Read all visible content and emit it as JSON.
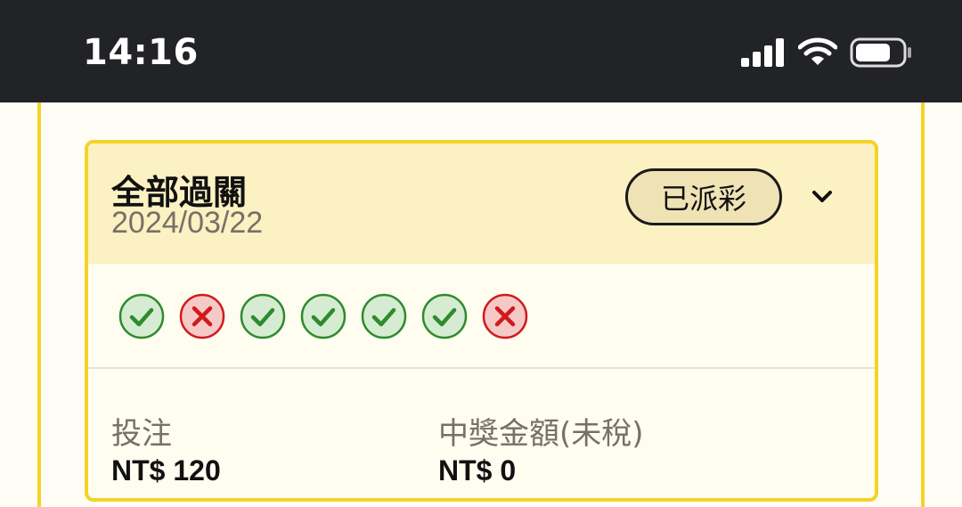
{
  "status_bar": {
    "time": "14:16"
  },
  "bet_card": {
    "type": "全部過關",
    "date": "2024/03/22",
    "status": "已派彩",
    "results": [
      "win",
      "lose",
      "win",
      "win",
      "win",
      "win",
      "lose"
    ],
    "stake": {
      "label": "投注",
      "value": "NT$ 120"
    },
    "payout": {
      "label": "中獎金額(未稅)",
      "value": "NT$ 0"
    }
  },
  "colors": {
    "accent": "#f5d326",
    "header_bg": "#fcf1c3",
    "win": "#2e8b2e",
    "lose": "#d01b1b"
  }
}
